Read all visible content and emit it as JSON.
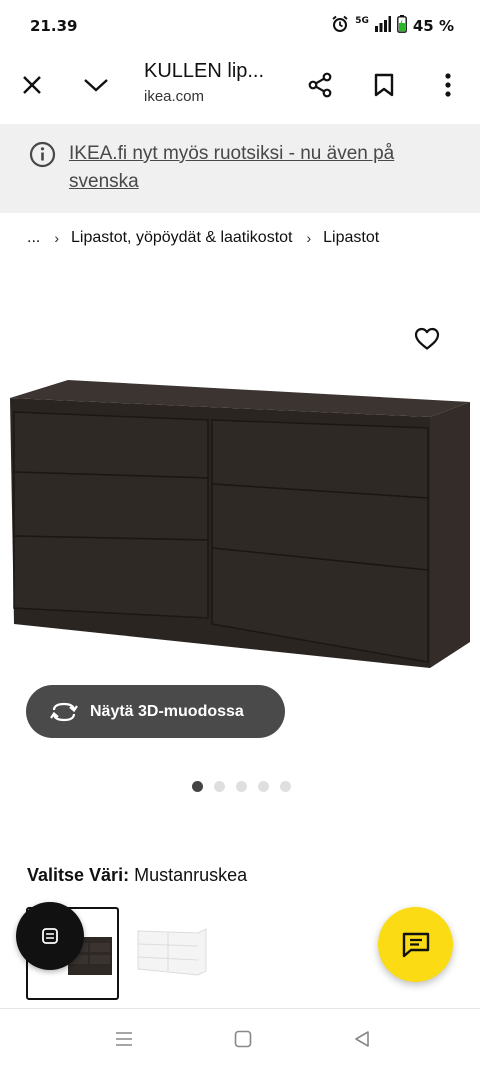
{
  "status_bar": {
    "time": "21.39",
    "network": "5G",
    "battery": "45 %"
  },
  "browser": {
    "title": "KULLEN lip...",
    "domain": "ikea.com"
  },
  "banner": {
    "text": "IKEA.fi nyt myös ruotsiksi - nu även på svenska"
  },
  "breadcrumb": {
    "ellipsis": "...",
    "items": [
      "Lipastot, yöpöydät & laatikostot",
      "Lipastot"
    ]
  },
  "gallery": {
    "view_3d_label": "Näytä 3D-muodossa",
    "dot_count": 5,
    "active_index": 0
  },
  "color": {
    "label": "Valitse Väri:",
    "value": "Mustanruskea",
    "swatches": [
      "black-brown",
      "white"
    ]
  },
  "colors": {
    "accent_yellow": "#fadb14",
    "dresser_dark": "#2f2a27",
    "banner_bg": "#f0f0f0"
  }
}
